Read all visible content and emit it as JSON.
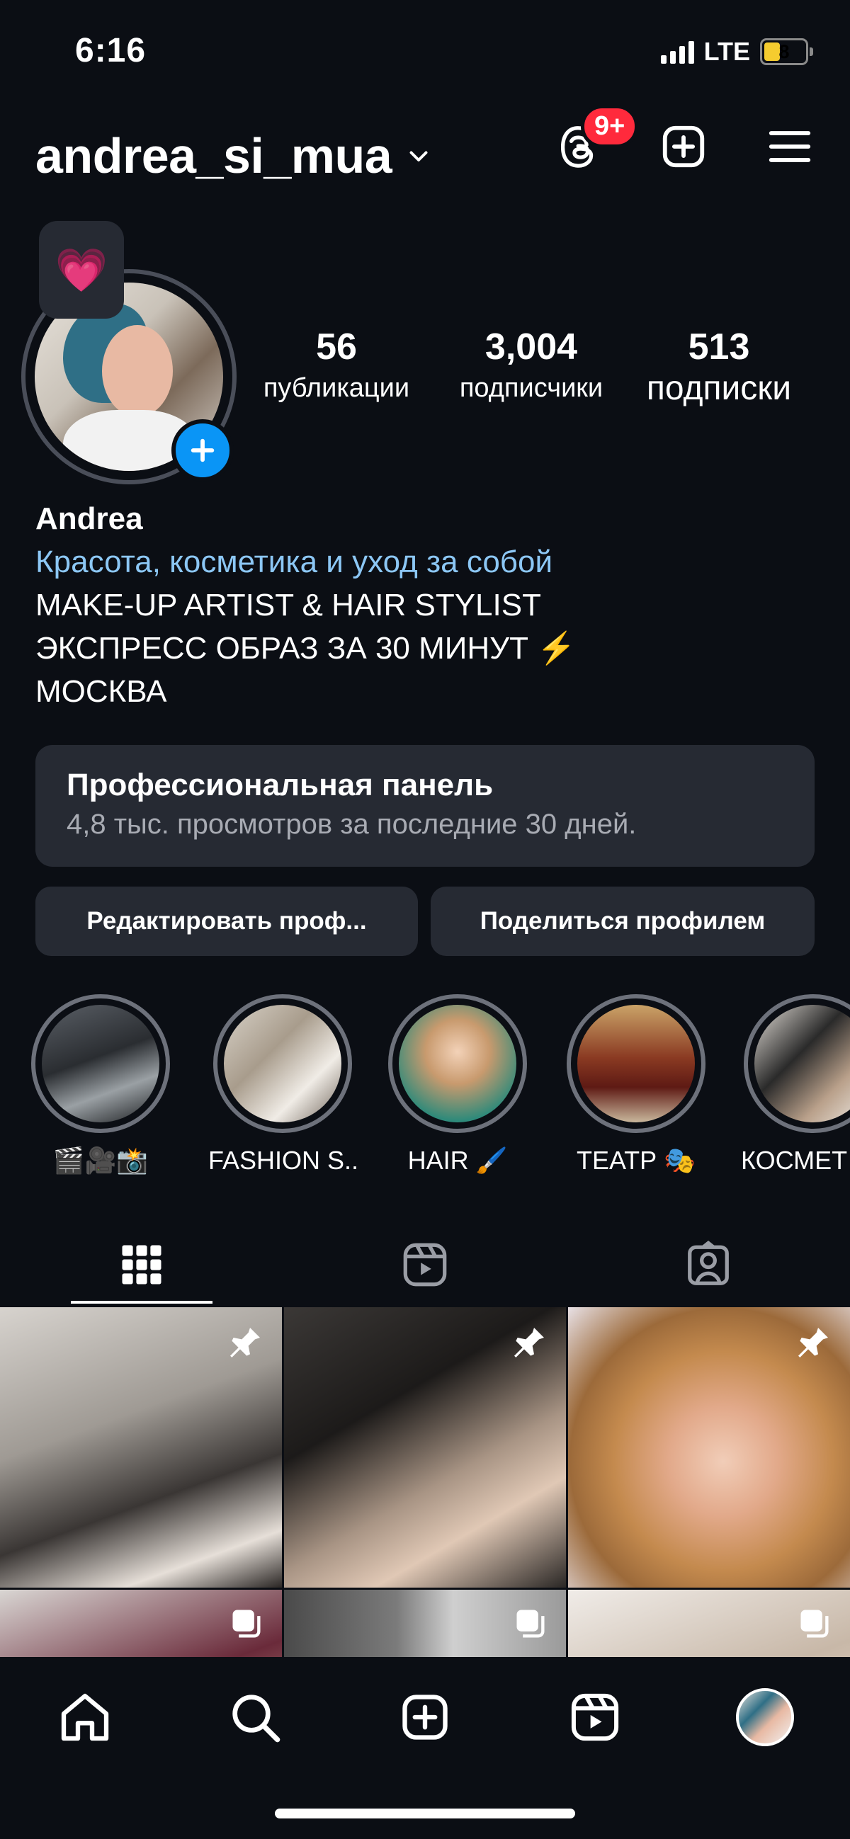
{
  "status": {
    "time": "6:16",
    "network": "LTE",
    "battery": "8"
  },
  "header": {
    "username": "andrea_si_mua",
    "threads_badge": "9+",
    "icons": [
      "chevron-down-icon",
      "threads-icon",
      "create-icon",
      "menu-icon"
    ]
  },
  "profile": {
    "note_emoji": "💗",
    "stats": [
      {
        "value": "56",
        "label": "публикации"
      },
      {
        "value": "3,004",
        "label": "подписчики"
      },
      {
        "value": "513",
        "label": "подписки"
      }
    ],
    "name": "Andrea",
    "category": "Красота, косметика и уход за собой",
    "bio_lines": [
      "MAKE-UP ARTIST & HAIR STYLIST",
      "ЭКСПРЕСС ОБРАЗ ЗА 30 МИНУТ ⚡️",
      "МОСКВА"
    ]
  },
  "dashboard": {
    "title": "Профессиональная панель",
    "subtitle": "4,8 тыс. просмотров за последние 30 дней."
  },
  "buttons": {
    "edit": "Редактировать проф...",
    "share": "Поделиться профилем"
  },
  "highlights": [
    {
      "label": "🎬🎥📸"
    },
    {
      "label": "FASHION S..."
    },
    {
      "label": "HAIR 🖌️"
    },
    {
      "label": "ТЕАТР 🎭"
    },
    {
      "label": "КОСМЕТ"
    }
  ],
  "tabs": [
    "grid-icon",
    "reels-icon",
    "tagged-icon"
  ],
  "bottom_nav": [
    "home-icon",
    "search-icon",
    "create-icon",
    "reels-icon",
    "profile-avatar"
  ],
  "colors": {
    "background": "#0b0e14",
    "card": "#262a33",
    "accent_blue": "#0a95f6",
    "badge_red": "#ff2a3c",
    "category_blue": "#8cc7f5"
  }
}
